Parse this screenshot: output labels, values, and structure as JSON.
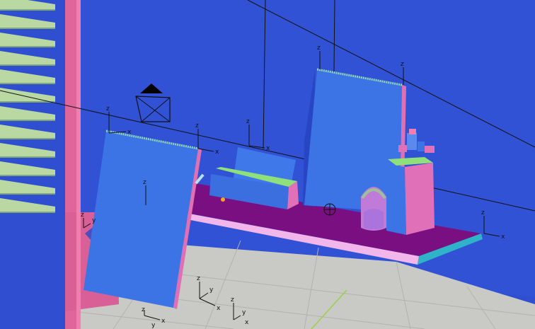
{
  "scene": {
    "colors": {
      "wall": "#2f4fd0",
      "wall_shade": "#2a46c4",
      "floor": "#c9c9c6",
      "floor_grid": "#b4b4b0",
      "shutter_slat": "#b9d8a2",
      "shutter_slat_shadow": "#7fa77a",
      "pillar_front": "#e0659a",
      "pillar_side": "#f07fb0",
      "shelf_top": "#7a0f82",
      "shelf_edge": "#f2b6ea",
      "shelf_side": "#2fb3c8",
      "panel_face": "#3c74e6",
      "panel_edge": "#8ed6b6",
      "panel_side": "#e070b4",
      "box_front": "#3b6fe0",
      "box_top": "#8fe07a",
      "box_side": "#e070b8",
      "dome": "#c07ad8",
      "gizmo_line": "#111111",
      "green_line": "#9bd04a",
      "marker": "#f5a623"
    },
    "gizmos": [
      {
        "name": "gizmo-panel-left",
        "labels": [
          "z",
          "x"
        ]
      },
      {
        "name": "gizmo-shelf-left",
        "labels": [
          "z",
          "x"
        ]
      },
      {
        "name": "gizmo-box",
        "labels": [
          "z",
          "x"
        ]
      },
      {
        "name": "gizmo-panel-right",
        "labels": [
          "z"
        ]
      },
      {
        "name": "gizmo-right-top",
        "labels": [
          "z"
        ]
      },
      {
        "name": "gizmo-shelf-right",
        "labels": [
          "z",
          "x"
        ]
      },
      {
        "name": "gizmo-floor-1",
        "labels": [
          "z",
          "x",
          "y"
        ]
      },
      {
        "name": "gizmo-floor-2",
        "labels": [
          "z",
          "x",
          "y"
        ]
      },
      {
        "name": "gizmo-floor-3",
        "labels": [
          "z",
          "x",
          "y"
        ]
      },
      {
        "name": "gizmo-bottom-left",
        "labels": [
          "z",
          "y"
        ]
      },
      {
        "name": "gizmo-wall-left",
        "labels": [
          "z"
        ]
      }
    ]
  }
}
